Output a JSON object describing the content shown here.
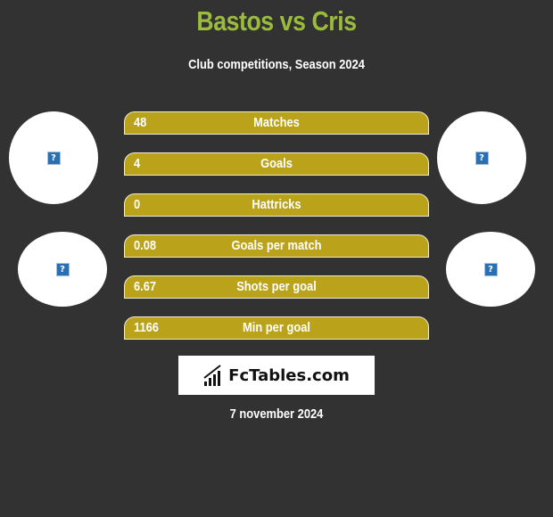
{
  "header": {
    "title": "Bastos vs Cris",
    "subtitle": "Club competitions, Season 2024"
  },
  "colors": {
    "background": "#323232",
    "title": "#9bbb3c",
    "bar_fill": "#baa31a",
    "bar_border": "#f2ecd0"
  },
  "logos": {
    "left_top": {
      "icon": "image-placeholder-icon",
      "glyph": "?"
    },
    "right_top": {
      "icon": "image-placeholder-icon",
      "glyph": "?"
    },
    "left_bottom": {
      "icon": "image-placeholder-icon",
      "glyph": "?"
    },
    "right_bottom": {
      "icon": "image-placeholder-icon",
      "glyph": "?"
    }
  },
  "stats": [
    {
      "value": "48",
      "label": "Matches"
    },
    {
      "value": "4",
      "label": "Goals"
    },
    {
      "value": "0",
      "label": "Hattricks"
    },
    {
      "value": "0.08",
      "label": "Goals per match"
    },
    {
      "value": "6.67",
      "label": "Shots per goal"
    },
    {
      "value": "1166",
      "label": "Min per goal"
    }
  ],
  "brand": {
    "name": "FcTables.com",
    "icon": "bar-chart-icon"
  },
  "footer": {
    "date": "7 november 2024"
  }
}
